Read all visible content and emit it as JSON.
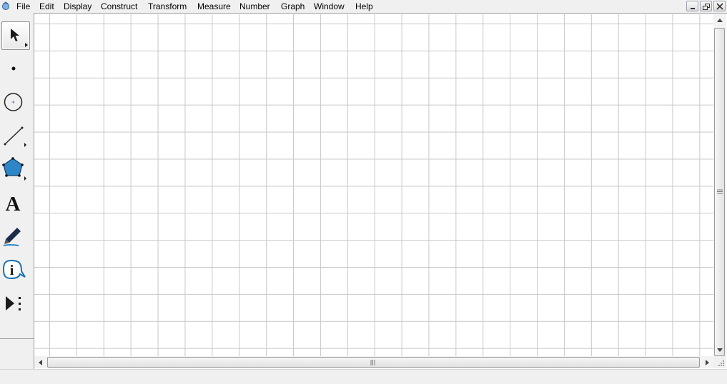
{
  "menubar": {
    "items": [
      "File",
      "Edit",
      "Display",
      "Construct",
      "Transform",
      "Measure",
      "Number",
      "Graph",
      "Window",
      "Help"
    ]
  },
  "window_controls": [
    "minimize-icon",
    "restore-icon",
    "close-icon"
  ],
  "toolbox": {
    "tools": [
      {
        "name": "arrow-selection-tool",
        "icon": "arrow-icon",
        "selected": true
      },
      {
        "name": "point-tool",
        "icon": "point-icon"
      },
      {
        "name": "compass-tool",
        "icon": "circle-icon"
      },
      {
        "name": "straightedge-tool",
        "icon": "segment-icon"
      },
      {
        "name": "polygon-tool",
        "icon": "pentagon-icon"
      },
      {
        "name": "text-tool",
        "icon": "letter-a-icon",
        "glyph": "A"
      },
      {
        "name": "marker-tool",
        "icon": "marker-icon"
      },
      {
        "name": "information-tool",
        "icon": "info-icon",
        "glyph": "i"
      },
      {
        "name": "custom-tools",
        "icon": "custom-tools-icon"
      }
    ]
  },
  "canvas": {
    "grid": true,
    "grid_color": "#c8c8c8",
    "background": "#ffffff"
  },
  "colors": {
    "polygon_fill": "#2e86c8",
    "info_blue": "#1a6fb0",
    "chrome": "#f0f0f0"
  }
}
